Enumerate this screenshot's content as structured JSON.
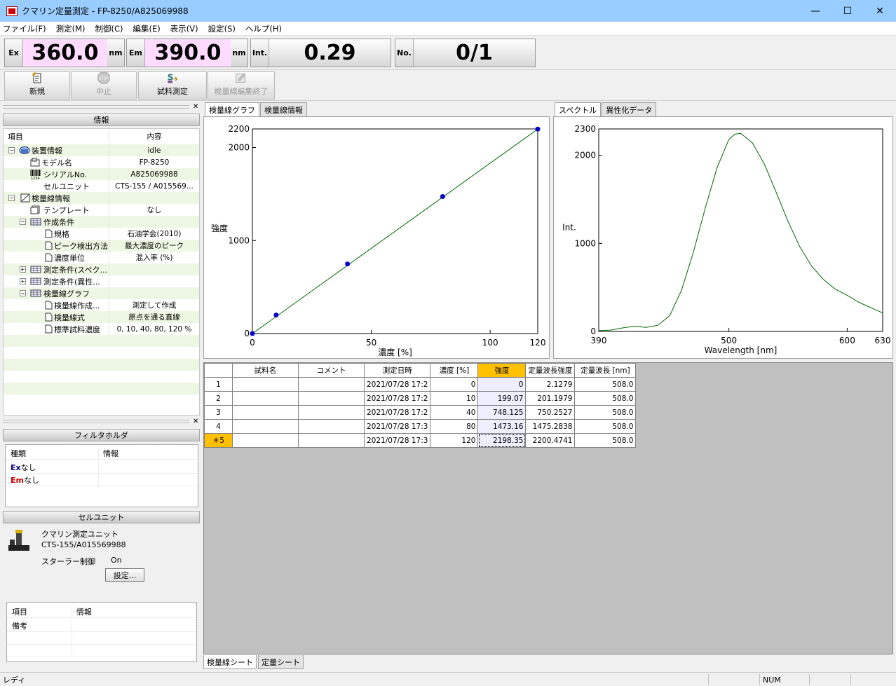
{
  "window": {
    "title": "クマリン定量測定 - FP-8250/A825069988",
    "min": "—",
    "max": "☐",
    "close": "✕"
  },
  "menu": [
    "ファイル(F)",
    "測定(M)",
    "制御(C)",
    "編集(E)",
    "表示(V)",
    "設定(S)",
    "ヘルプ(H)"
  ],
  "readout": {
    "ex_label": "Ex",
    "ex_value": "360.0",
    "ex_unit": "nm",
    "em_label": "Em",
    "em_value": "390.0",
    "em_unit": "nm",
    "int_label": "Int.",
    "int_value": "0.29",
    "no_label": "No.",
    "no_value": "0/1"
  },
  "toolbar": {
    "new": "新規",
    "stop": "中止",
    "stop_icon_text": "STOP",
    "measure": "試料測定",
    "end_edit": "検量線編集終了"
  },
  "info_panel": {
    "header": "情報",
    "col_item": "項目",
    "col_content": "内容",
    "rows": [
      {
        "label": "装置情報",
        "value": "idle"
      },
      {
        "label": "モデル名",
        "value": "FP-8250"
      },
      {
        "label": "シリアルNo.",
        "value": "A825069988"
      },
      {
        "label": "セルユニット",
        "value": "CTS-155 / A015569..."
      },
      {
        "label": "検量線情報",
        "value": ""
      },
      {
        "label": "テンプレート",
        "value": "なし"
      },
      {
        "label": "作成条件",
        "value": ""
      },
      {
        "label": "規格",
        "value": "石油学会(2010)"
      },
      {
        "label": "ピーク検出方法",
        "value": "最大濃度のピーク"
      },
      {
        "label": "濃度単位",
        "value": "混入率 (%)"
      },
      {
        "label": "測定条件(スペク...",
        "value": ""
      },
      {
        "label": "測定条件(異性...",
        "value": ""
      },
      {
        "label": "検量線グラフ",
        "value": ""
      },
      {
        "label": "検量線作成...",
        "value": "測定して作成"
      },
      {
        "label": "検量線式",
        "value": "原点を通る直線"
      },
      {
        "label": "標準試料濃度",
        "value": "0, 10, 40, 80, 120 %"
      }
    ],
    "serial_icon_text": "1234"
  },
  "filter_panel": {
    "header": "フィルタホルダ",
    "col_type": "種類",
    "col_info": "情報",
    "ex_badge": "Ex",
    "em_badge": "Em",
    "ex_value": "なし",
    "em_value": "なし"
  },
  "cell_panel": {
    "header": "セルユニット",
    "name": "クマリン測定ユニット",
    "serial": "CTS-155/A015569988",
    "stirrer_label": "スターラー制御",
    "stirrer_value": "On",
    "settings_button": "設定...",
    "note_col_item": "項目",
    "note_col_info": "情報",
    "note_row": "備考"
  },
  "graph_tabs": [
    "検量線グラフ",
    "検量線情報"
  ],
  "spectrum_tabs": [
    "スペクトル",
    "異性化データ"
  ],
  "chart_data": [
    {
      "type": "scatter",
      "xlabel": "濃度 [%]",
      "ylabel": "強度",
      "xlim": [
        0,
        120
      ],
      "ylim": [
        0,
        2200
      ],
      "xticks": [
        "0",
        "50",
        "100",
        "120"
      ],
      "yticks": [
        "0",
        "1000",
        "2000",
        "2200"
      ],
      "x": [
        0,
        10,
        40,
        80,
        120
      ],
      "y": [
        0,
        199.07,
        748.125,
        1473.16,
        2198.35
      ],
      "fit_line": [
        [
          0,
          0
        ],
        [
          120,
          2198.35
        ]
      ],
      "point_color": "#0000cc",
      "line_color": "#006600"
    },
    {
      "type": "line",
      "xlabel": "Wavelength [nm]",
      "ylabel": "Int.",
      "xlim": [
        390,
        630
      ],
      "ylim": [
        0,
        2300
      ],
      "xticks": [
        "390",
        "500",
        "600",
        "630"
      ],
      "yticks": [
        "0",
        "1000",
        "2000",
        "2300"
      ],
      "x": [
        390,
        400,
        410,
        420,
        430,
        440,
        450,
        460,
        470,
        480,
        490,
        500,
        505,
        510,
        520,
        530,
        540,
        550,
        560,
        570,
        580,
        590,
        600,
        610,
        620,
        630
      ],
      "y": [
        10,
        15,
        40,
        60,
        45,
        70,
        180,
        470,
        900,
        1400,
        1860,
        2180,
        2240,
        2250,
        2140,
        1900,
        1580,
        1250,
        960,
        740,
        590,
        480,
        410,
        330,
        270,
        210
      ],
      "line_color": "#006600"
    }
  ],
  "table": {
    "headers": [
      "",
      "試料名",
      "コメント",
      "測定日時",
      "濃度 [%]",
      "強度",
      "定量波長強度",
      "定量波長 [nm]"
    ],
    "rows": [
      {
        "n": "1",
        "name": "",
        "comment": "",
        "date": "2021/07/28 17:2",
        "conc": "0",
        "int": "0",
        "qint": "2.1279",
        "wl": "508.0"
      },
      {
        "n": "2",
        "name": "",
        "comment": "",
        "date": "2021/07/28 17:2",
        "conc": "10",
        "int": "199.07",
        "qint": "201.1979",
        "wl": "508.0"
      },
      {
        "n": "3",
        "name": "",
        "comment": "",
        "date": "2021/07/28 17:2",
        "conc": "40",
        "int": "748.125",
        "qint": "750.2527",
        "wl": "508.0"
      },
      {
        "n": "4",
        "name": "",
        "comment": "",
        "date": "2021/07/28 17:3",
        "conc": "80",
        "int": "1473.16",
        "qint": "1475.2838",
        "wl": "508.0"
      },
      {
        "n": "＊5",
        "name": "",
        "comment": "",
        "date": "2021/07/28 17:3",
        "conc": "120",
        "int": "2198.35",
        "qint": "2200.4741",
        "wl": "508.0"
      }
    ]
  },
  "sheet_tabs": [
    "検量線シート",
    "定量シート"
  ],
  "status": {
    "text": "レディ",
    "num": "NUM"
  }
}
